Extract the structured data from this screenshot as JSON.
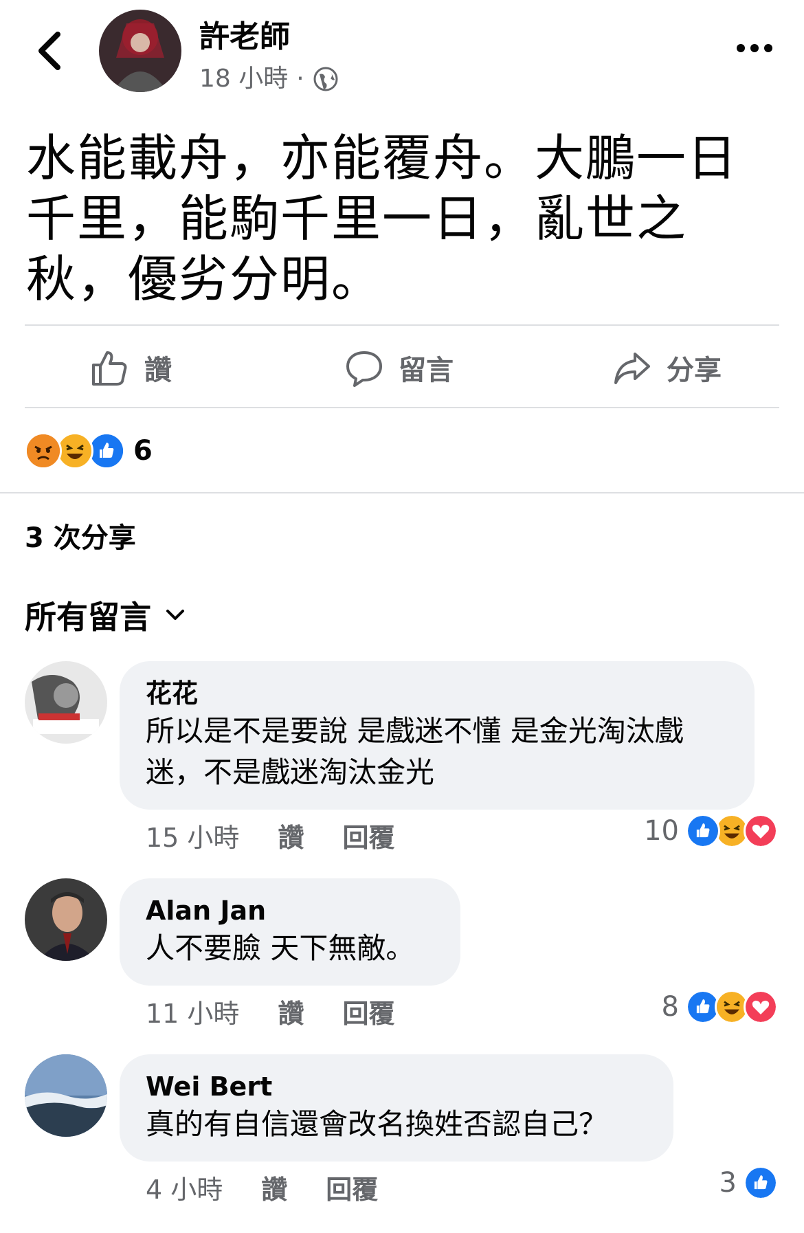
{
  "header": {
    "author": "許老師",
    "time": "18 小時",
    "separator": "·",
    "privacy_icon": "globe-icon"
  },
  "post": {
    "text": "水能載舟，亦能覆舟。大鵬一日千里，能駒千里一日，亂世之秋，優劣分明。"
  },
  "actions": {
    "like": "讚",
    "comment": "留言",
    "share": "分享"
  },
  "reactions": {
    "icons": [
      "angry-icon",
      "haha-icon",
      "like-icon"
    ],
    "count": "6"
  },
  "shares": "3 次分享",
  "comments_filter": "所有留言",
  "comments": [
    {
      "name": "花花",
      "text": "所以是不是要說 是戲迷不懂 是金光淘汰戲迷，不是戲迷淘汰金光",
      "time": "15 小時",
      "like": "讚",
      "reply": "回覆",
      "reaction_count": "10",
      "reaction_icons": [
        "like-icon",
        "haha-icon",
        "love-icon"
      ]
    },
    {
      "name": "Alan Jan",
      "text": "人不要臉 天下無敵。",
      "time": "11 小時",
      "like": "讚",
      "reply": "回覆",
      "reaction_count": "8",
      "reaction_icons": [
        "like-icon",
        "haha-icon",
        "love-icon"
      ]
    },
    {
      "name": "Wei Bert",
      "text": "真的有自信還會改名換姓否認自己？",
      "time": "4 小時",
      "like": "讚",
      "reply": "回覆",
      "reaction_count": "3",
      "reaction_icons": [
        "like-icon"
      ]
    }
  ],
  "colors": {
    "like_blue": "#1877f2",
    "haha_yellow": "#f7b125",
    "love_red": "#f33e58",
    "angry_orange": "#e9710f",
    "bubble_bg": "#f0f2f5",
    "secondary_text": "#65676b"
  }
}
